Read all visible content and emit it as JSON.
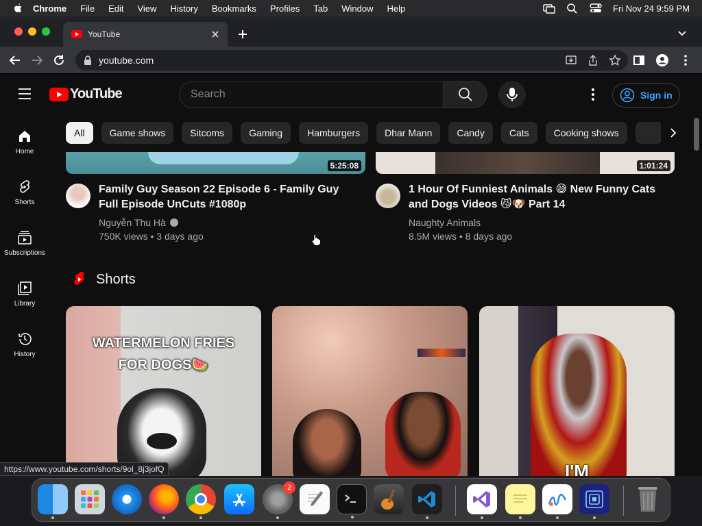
{
  "menubar": {
    "app": "Chrome",
    "items": [
      "File",
      "Edit",
      "View",
      "History",
      "Bookmarks",
      "Profiles",
      "Tab",
      "Window",
      "Help"
    ],
    "clock": "Fri Nov 24  9:59 PM"
  },
  "tab": {
    "title": "YouTube"
  },
  "address": {
    "url": "youtube.com"
  },
  "header": {
    "logo_text": "YouTube",
    "search_placeholder": "Search",
    "signin_label": "Sign in"
  },
  "sidebar": {
    "items": [
      {
        "label": "Home",
        "icon": "home-icon"
      },
      {
        "label": "Shorts",
        "icon": "shorts-icon"
      },
      {
        "label": "Subscriptions",
        "icon": "subscriptions-icon"
      },
      {
        "label": "Library",
        "icon": "library-icon"
      },
      {
        "label": "History",
        "icon": "history-icon"
      }
    ]
  },
  "chips": [
    "All",
    "Game shows",
    "Sitcoms",
    "Gaming",
    "Hamburgers",
    "Dhar Mann",
    "Candy",
    "Cats",
    "Cooking shows"
  ],
  "videos": [
    {
      "duration": "5:25:08",
      "title": "Family Guy Season 22 Episode 6 - Family Guy Full Episode UnCuts #1080p",
      "channel": "Nguyễn Thu Hà",
      "stats": "750K views • 3 days ago"
    },
    {
      "duration": "1:01:24",
      "title": "1 Hour Of Funniest Animals 😅 New Funny Cats and Dogs Videos 😼🐶 Part 14",
      "channel": "Naughty Animals",
      "stats": "8.5M views • 8 days ago"
    }
  ],
  "shorts": {
    "heading": "Shorts",
    "items": [
      {
        "caption_line1": "WATERMELON FRIES",
        "caption_line2": "FOR DOGS🍉"
      },
      {
        "caption_line1": "",
        "caption_line2": ""
      },
      {
        "caption_line1": "I'M",
        "caption_line2": ""
      }
    ]
  },
  "status_url": "https://www.youtube.com/shorts/9ol_8j3jofQ",
  "dock": {
    "settings_badge": "2"
  },
  "colors": {
    "yt_red": "#ff0000",
    "link_blue": "#3ea6ff",
    "bg": "#0f0f0f",
    "chip_bg": "#272727"
  }
}
